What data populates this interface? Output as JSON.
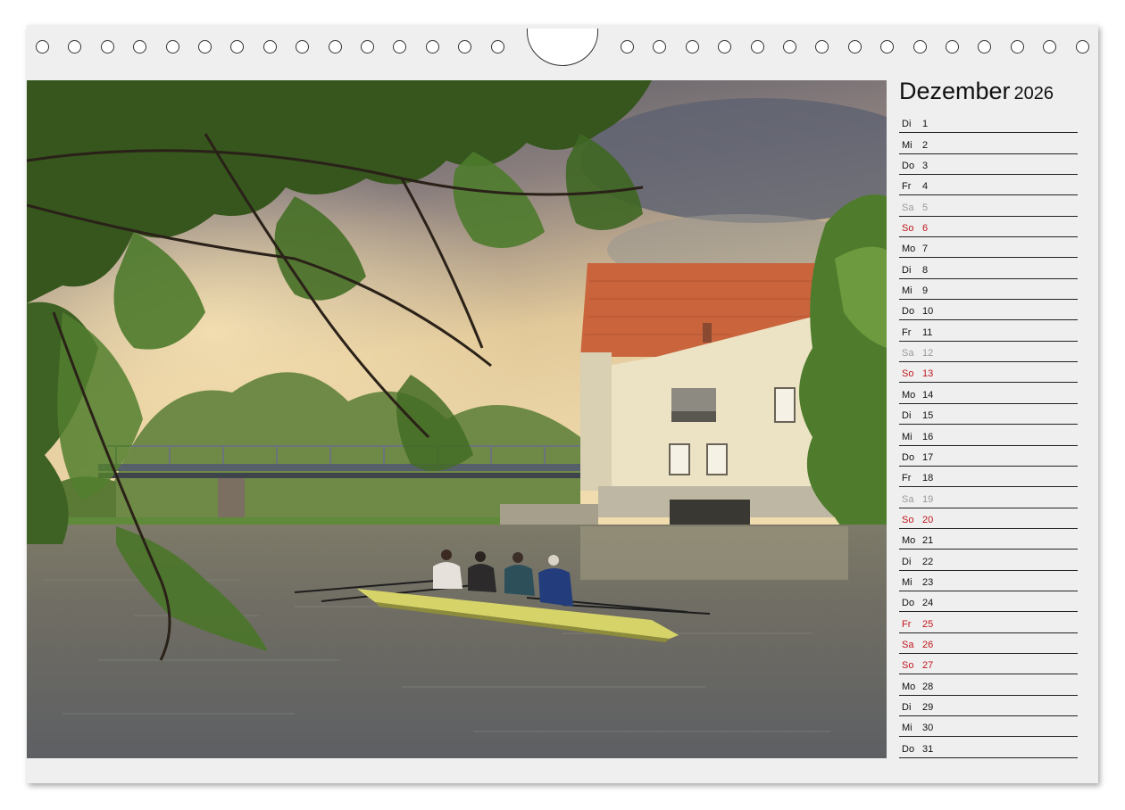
{
  "calendar": {
    "month": "Dezember",
    "year": "2026",
    "photo": {
      "subject": "Vierer-Ruderboot auf dem Fluss vor einer Mühle mit rotem Ziegeldach, Brücke im Hintergrund"
    },
    "days": [
      {
        "weekday": "Di",
        "day": "1",
        "type": "normal"
      },
      {
        "weekday": "Mi",
        "day": "2",
        "type": "normal"
      },
      {
        "weekday": "Do",
        "day": "3",
        "type": "normal"
      },
      {
        "weekday": "Fr",
        "day": "4",
        "type": "normal"
      },
      {
        "weekday": "Sa",
        "day": "5",
        "type": "saturday"
      },
      {
        "weekday": "So",
        "day": "6",
        "type": "holiday"
      },
      {
        "weekday": "Mo",
        "day": "7",
        "type": "normal"
      },
      {
        "weekday": "Di",
        "day": "8",
        "type": "normal"
      },
      {
        "weekday": "Mi",
        "day": "9",
        "type": "normal"
      },
      {
        "weekday": "Do",
        "day": "10",
        "type": "normal"
      },
      {
        "weekday": "Fr",
        "day": "11",
        "type": "normal"
      },
      {
        "weekday": "Sa",
        "day": "12",
        "type": "saturday"
      },
      {
        "weekday": "So",
        "day": "13",
        "type": "holiday"
      },
      {
        "weekday": "Mo",
        "day": "14",
        "type": "normal"
      },
      {
        "weekday": "Di",
        "day": "15",
        "type": "normal"
      },
      {
        "weekday": "Mi",
        "day": "16",
        "type": "normal"
      },
      {
        "weekday": "Do",
        "day": "17",
        "type": "normal"
      },
      {
        "weekday": "Fr",
        "day": "18",
        "type": "normal"
      },
      {
        "weekday": "Sa",
        "day": "19",
        "type": "saturday"
      },
      {
        "weekday": "So",
        "day": "20",
        "type": "holiday"
      },
      {
        "weekday": "Mo",
        "day": "21",
        "type": "normal"
      },
      {
        "weekday": "Di",
        "day": "22",
        "type": "normal"
      },
      {
        "weekday": "Mi",
        "day": "23",
        "type": "normal"
      },
      {
        "weekday": "Do",
        "day": "24",
        "type": "normal"
      },
      {
        "weekday": "Fr",
        "day": "25",
        "type": "holiday"
      },
      {
        "weekday": "Sa",
        "day": "26",
        "type": "holiday"
      },
      {
        "weekday": "So",
        "day": "27",
        "type": "holiday"
      },
      {
        "weekday": "Mo",
        "day": "28",
        "type": "normal"
      },
      {
        "weekday": "Di",
        "day": "29",
        "type": "normal"
      },
      {
        "weekday": "Mi",
        "day": "30",
        "type": "normal"
      },
      {
        "weekday": "Do",
        "day": "31",
        "type": "normal"
      }
    ]
  },
  "colors": {
    "normal": "#111111",
    "saturday": "#9a9a9a",
    "holiday": "#c0161c"
  }
}
